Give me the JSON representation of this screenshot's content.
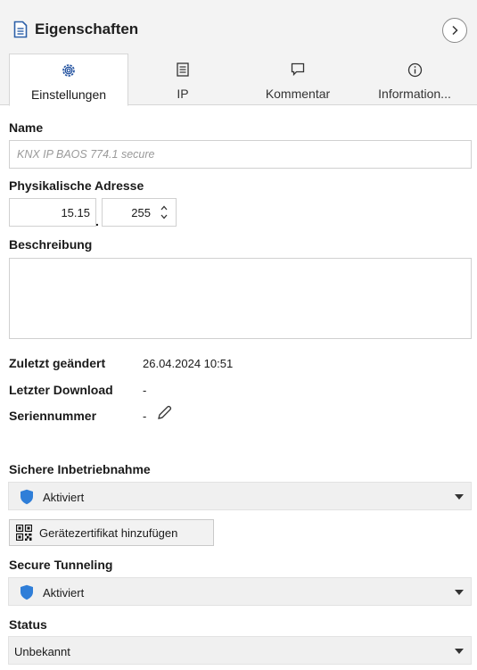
{
  "header": {
    "title": "Eigenschaften"
  },
  "tabs": [
    {
      "label": "Einstellungen",
      "icon": "gear-icon",
      "active": true
    },
    {
      "label": "IP",
      "icon": "list-icon",
      "active": false
    },
    {
      "label": "Kommentar",
      "icon": "comment-icon",
      "active": false
    },
    {
      "label": "Information...",
      "icon": "info-icon",
      "active": false
    }
  ],
  "form": {
    "name_label": "Name",
    "name_placeholder": "KNX IP BAOS 774.1 secure",
    "address_label": "Physikalische Adresse",
    "address_area": "15.15",
    "address_separator": ".",
    "address_device": "255",
    "description_label": "Beschreibung",
    "description_value": ""
  },
  "info": {
    "last_modified_label": "Zuletzt geändert",
    "last_modified_value": "26.04.2024 10:51",
    "last_download_label": "Letzter Download",
    "last_download_value": "-",
    "serial_label": "Seriennummer",
    "serial_value": "-"
  },
  "secure_commissioning": {
    "label": "Sichere Inbetriebnahme",
    "value": "Aktiviert",
    "cert_button_label": "Gerätezertifikat hinzufügen"
  },
  "secure_tunneling": {
    "label": "Secure Tunneling",
    "value": "Aktiviert"
  },
  "status": {
    "label": "Status",
    "value": "Unbekannt"
  },
  "colors": {
    "shield": "#2f7ed8",
    "header_bg": "#f3f3f3",
    "dropdown_bg": "#f0f0f0"
  }
}
